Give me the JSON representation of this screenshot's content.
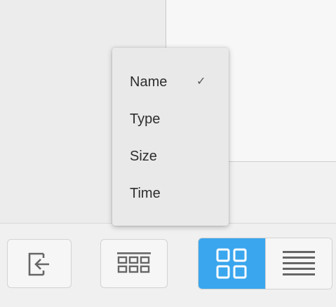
{
  "sort_menu": {
    "items": [
      {
        "label": "Name",
        "checked": true
      },
      {
        "label": "Type",
        "checked": false
      },
      {
        "label": "Size",
        "checked": false
      },
      {
        "label": "Time",
        "checked": false
      }
    ],
    "check_glyph": "✓"
  },
  "toolbar": {
    "exit_icon": "exit-icon",
    "columns_icon": "columns-grid-icon",
    "view_mode": {
      "options": [
        "grid",
        "list"
      ],
      "selected": "grid"
    }
  },
  "colors": {
    "accent": "#3aa6ee",
    "menu_bg": "#e9e9e9"
  }
}
